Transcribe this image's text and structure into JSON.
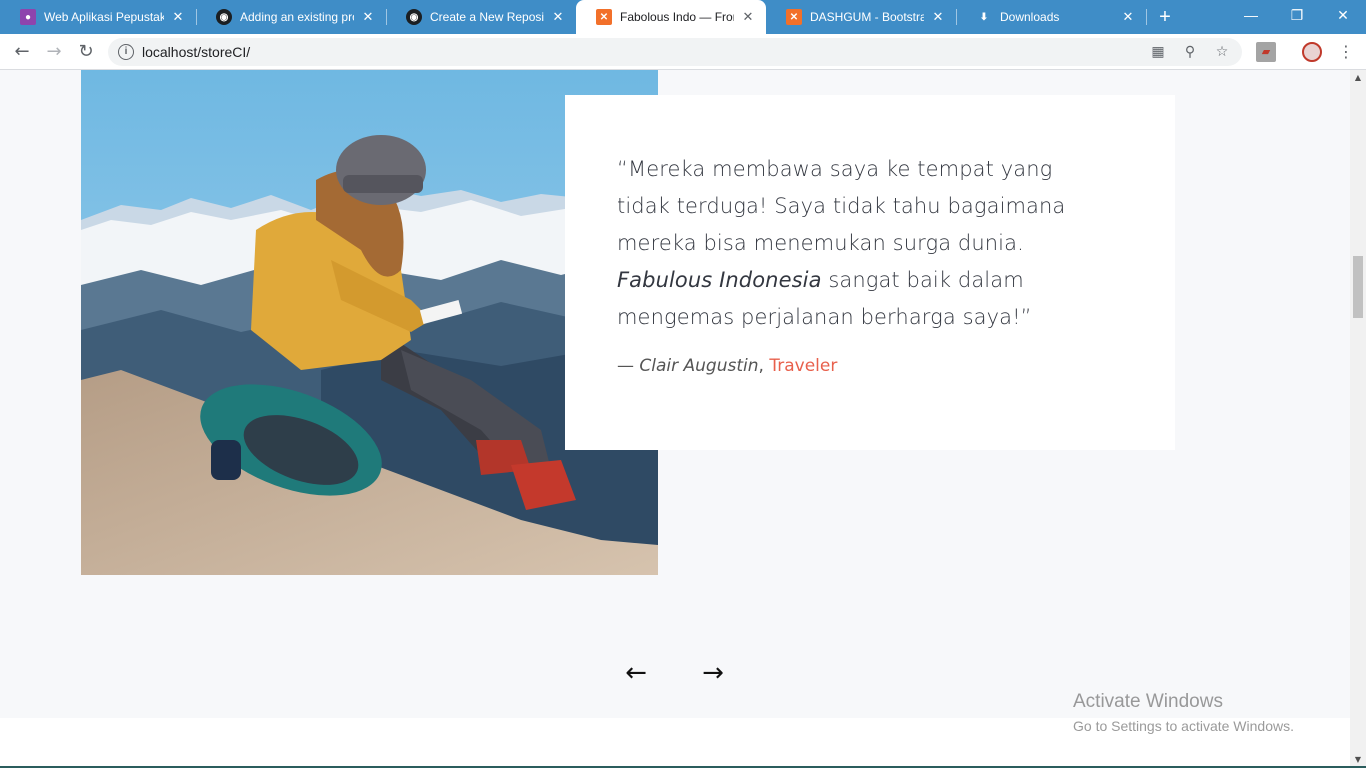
{
  "browser": {
    "tabs": [
      {
        "title": "Web Aplikasi Pepustaka",
        "icon": "person-icon",
        "active": false
      },
      {
        "title": "Adding an existing proj",
        "icon": "github-icon",
        "active": false
      },
      {
        "title": "Create a New Reposito",
        "icon": "github-icon",
        "active": false
      },
      {
        "title": "Fabolous Indo — From",
        "icon": "xampp-icon",
        "active": true
      },
      {
        "title": "DASHGUM - Bootstrap",
        "icon": "xampp-icon",
        "active": false
      },
      {
        "title": "Downloads",
        "icon": "download-icon",
        "active": false
      }
    ],
    "new_tab": "+",
    "window_controls": {
      "minimize": "—",
      "restore": "❐",
      "close": "✕"
    },
    "nav": {
      "back": "←",
      "forward": "→",
      "reload": "↻"
    },
    "url": "localhost/storeCI/",
    "omnibox_icons": {
      "translate": "translate-icon",
      "zoom": "zoom-icon",
      "bookmark": "star-icon"
    }
  },
  "testimonial": {
    "open_quote": "“",
    "line1": "Mereka membawa saya ke tempat yang",
    "line2": "tidak terduga! Saya tidak tahu bagaimana",
    "line3": "mereka bisa menemukan surga dunia.",
    "emphasis": "Fabulous Indonesia",
    "line4_rest": " sangat baik dalam",
    "line5": "mengemas perjalanan berharga saya!”",
    "author_prefix": "— ",
    "author_name": "Clair Augustin",
    "author_sep": ", ",
    "author_role": "Traveler"
  },
  "slider": {
    "prev": "←",
    "next": "→"
  },
  "watermark": {
    "title": "Activate Windows",
    "subtitle": "Go to Settings to activate Windows."
  },
  "colors": {
    "tabstrip": "#3f8dc7",
    "accent": "#e8604c",
    "page_bg": "#f7f8fa"
  }
}
